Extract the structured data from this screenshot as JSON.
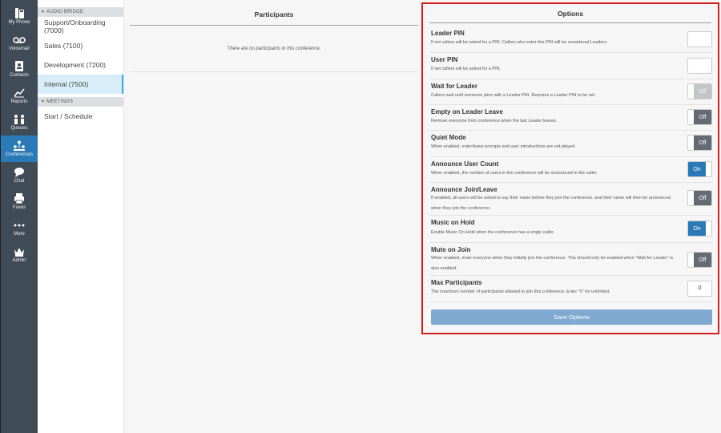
{
  "nav": {
    "items": [
      {
        "label": "My Phone",
        "icon": "phone-icon"
      },
      {
        "label": "Voicemail",
        "icon": "voicemail-icon"
      },
      {
        "label": "Contacts",
        "icon": "contacts-icon"
      },
      {
        "label": "Reports",
        "icon": "reports-icon"
      },
      {
        "label": "Queues",
        "icon": "queues-icon"
      },
      {
        "label": "Conferences",
        "icon": "conferences-icon"
      },
      {
        "label": "Chat",
        "icon": "chat-icon"
      },
      {
        "label": "Faxes",
        "icon": "fax-icon"
      },
      {
        "label": "More",
        "icon": "more-icon"
      },
      {
        "label": "Admin",
        "icon": "admin-icon"
      }
    ],
    "active_color": "#2b7ab8"
  },
  "sub": {
    "audio_bridge_header": "AUDIO BRIDGE",
    "bridges": [
      {
        "label": "Support/Onboarding (7000)"
      },
      {
        "label": "Sales (7100)"
      },
      {
        "label": "Development (7200)"
      },
      {
        "label": "Internal (7500)"
      }
    ],
    "meetings_header": "MEETINGS",
    "meetings": [
      {
        "label": "Start / Schedule"
      }
    ]
  },
  "participants": {
    "title": "Participants",
    "empty_text": "There are no participants in this conference."
  },
  "options": {
    "title": "Options",
    "leader_pin": {
      "label": "Leader PIN",
      "desc": "If set callers will be asked for a PIN. Callers who enter this PIN will be considered Leaders.",
      "value": ""
    },
    "user_pin": {
      "label": "User PIN",
      "desc": "If set callers will be asked for a PIN.",
      "value": ""
    },
    "wait_for_leader": {
      "label": "Wait for Leader",
      "desc": "Callers wait until someone joins with a Leader PIN. Requires a Leader PIN to be set.",
      "state": "Off"
    },
    "empty_on_leader_leave": {
      "label": "Empty on Leader Leave",
      "desc": "Remove everyone from conference when the last Leader leaves.",
      "state": "Off"
    },
    "quiet_mode": {
      "label": "Quiet Mode",
      "desc": "When enabled, enter/leave prompts and user introductions are not played.",
      "state": "Off"
    },
    "announce_user_count": {
      "label": "Announce User Count",
      "desc": "When enabled, the number of users in the conference will be announced to the caller.",
      "state": "On"
    },
    "announce_join_leave": {
      "label": "Announce Join/Leave",
      "desc": "If enabled, all users will be asked to say their name before they join the conference, and their name will then be announced when they join the conference.",
      "state": "Off"
    },
    "music_on_hold": {
      "label": "Music on Hold",
      "desc": "Enable Music On Hold when the conference has a single caller.",
      "state": "On"
    },
    "mute_on_join": {
      "label": "Mute on Join",
      "desc": "When enabled, mute everyone when they initially join the conference. This should only be enabled when \"Wait for Leader\" is also enabled.",
      "state": "Off"
    },
    "max_participants": {
      "label": "Max Participants",
      "desc": "The maximum number of participants allowed to join this conference. Enter \"0\" for unlimited.",
      "value": "0"
    },
    "save_label": "Save Options"
  }
}
